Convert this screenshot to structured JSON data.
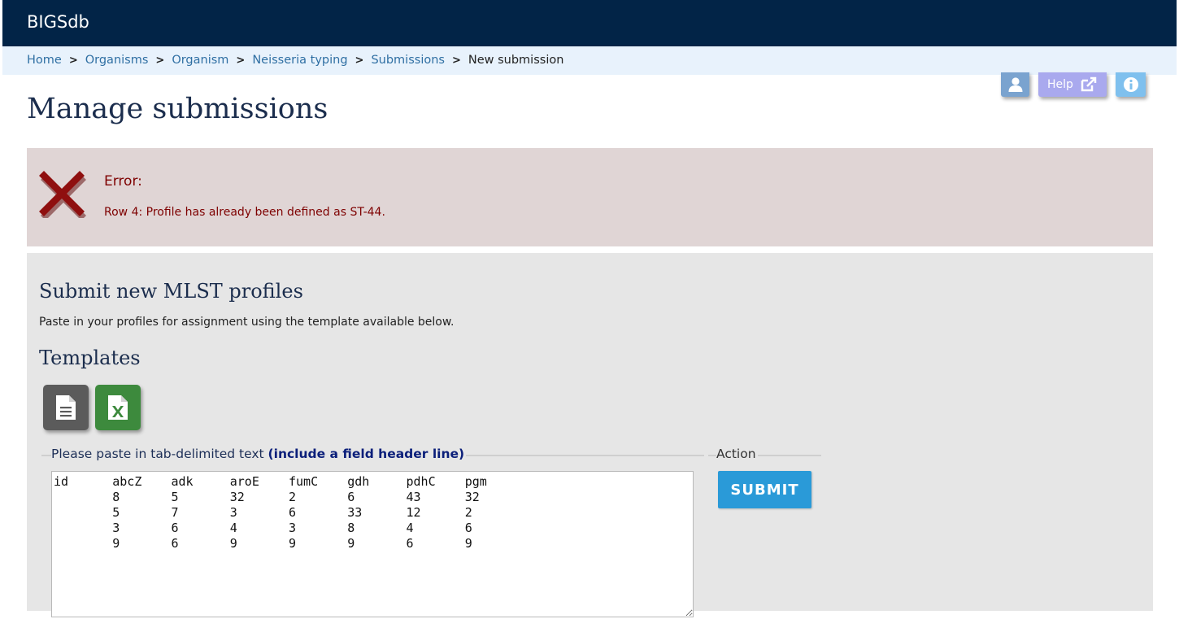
{
  "header": {
    "title": "BIGSdb"
  },
  "breadcrumb": {
    "items": [
      "Home",
      "Organisms",
      "Organism",
      "Neisseria typing",
      "Submissions"
    ],
    "separator": ">",
    "current": "New submission"
  },
  "toolbar": {
    "user_icon": "user-icon",
    "help_label": "Help",
    "help_icon": "external-link-icon",
    "info_icon": "info-icon"
  },
  "page": {
    "title": "Manage submissions"
  },
  "error": {
    "icon": "error-cross-icon",
    "title": "Error:",
    "message": "Row 4: Profile has already been defined as ST-44.",
    "color": "#7e0000"
  },
  "submit_section": {
    "heading": "Submit new MLST profiles",
    "intro": "Paste in your profiles for assignment using the template available below.",
    "templates_heading": "Templates",
    "template_buttons": [
      {
        "icon": "text-file-icon",
        "color": "#5b5b5b"
      },
      {
        "icon": "excel-file-icon",
        "color": "#3d8a3d"
      }
    ],
    "paste_legend": "Please paste in tab-delimited text ",
    "paste_legend_bold": "(include a field header line)",
    "paste_value": "id\tabcZ\tadk\taroE\tfumC\tgdh\tpdhC\tpgm\n\t8\t5\t32\t2\t6\t43\t32\n\t5\t7\t3\t6\t33\t12\t2\n\t3\t6\t4\t3\t8\t4\t6\n\t9\t6\t9\t9\t9\t6\t9",
    "action_legend": "Action",
    "submit_label": "SUBMIT",
    "submit_color": "#2a9ad8"
  }
}
